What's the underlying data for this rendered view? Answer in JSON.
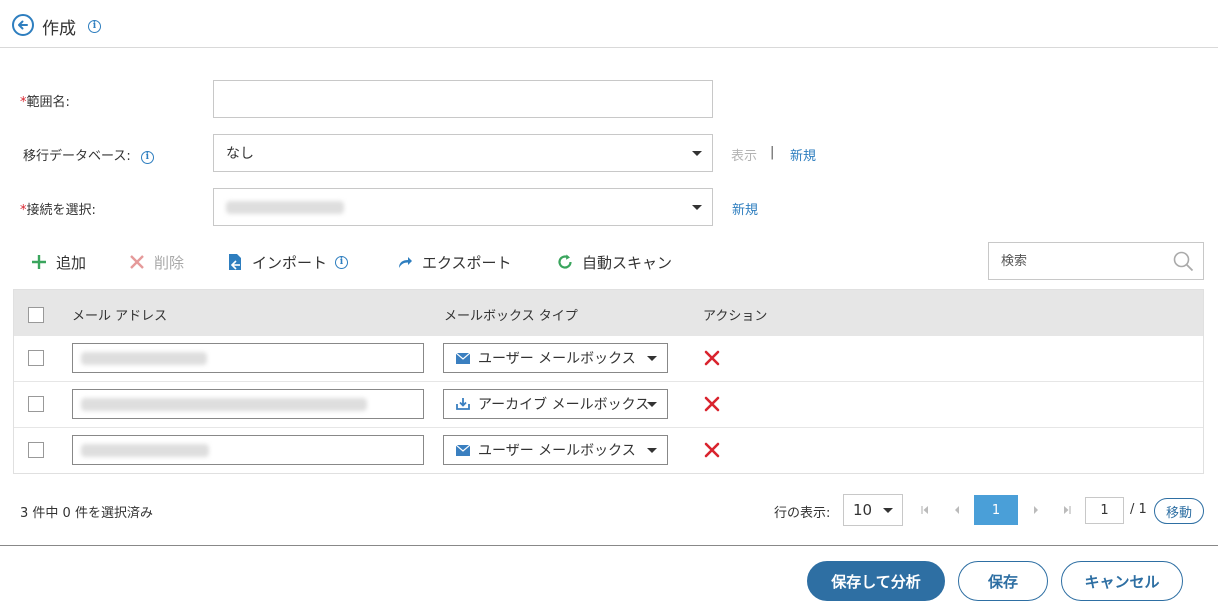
{
  "header": {
    "title": "作成"
  },
  "form": {
    "scope_name": {
      "required_mark": "*",
      "label": "範囲名:",
      "value": ""
    },
    "migration_db": {
      "label": "移行データベース:",
      "value": "なし",
      "view_link": "表示",
      "separator": "|",
      "new_link": "新規"
    },
    "connection": {
      "required_mark": "*",
      "label": "接続を選択:",
      "new_link": "新規"
    }
  },
  "toolbar": {
    "add": "追加",
    "delete": "削除",
    "import": "インポート",
    "export": "エクスポート",
    "auto_scan": "自動スキャン",
    "search_placeholder": "検索"
  },
  "grid": {
    "columns": [
      "メール アドレス",
      "メールボックス タイプ",
      "アクション"
    ],
    "rows": [
      {
        "mailbox_type": "ユーザー メールボックス",
        "icon": "envelope-icon"
      },
      {
        "mailbox_type": "アーカイブ メールボックス",
        "icon": "archive-download-icon"
      },
      {
        "mailbox_type": "ユーザー メールボックス",
        "icon": "envelope-icon"
      }
    ]
  },
  "pagination": {
    "summary": "3 件中 0 件を選択済み",
    "rows_label": "行の表示:",
    "rows_per_page": "10",
    "current_page": "1",
    "page_input": "1",
    "total_pages": "/ 1",
    "go_label": "移動"
  },
  "footer": {
    "save_analyze": "保存して分析",
    "save": "保存",
    "cancel": "キャンセル"
  },
  "colors": {
    "accent": "#2e7ebf",
    "primary_button": "#2e6fa3",
    "danger": "#d9232e",
    "header_bg": "#e6e6e6"
  }
}
